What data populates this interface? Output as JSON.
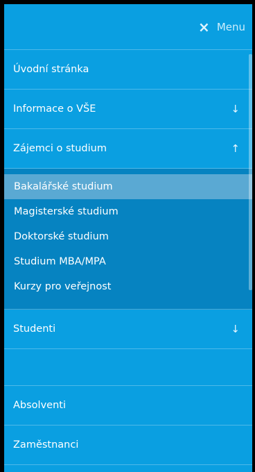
{
  "header": {
    "close_label": "Menu",
    "close_icon": "×"
  },
  "menu": {
    "uvod": "Úvodní stránka",
    "informace": "Informace o VŠE",
    "zajemci": "Zájemci o studium",
    "studenti": "Studenti",
    "absolventi": "Absolventi",
    "zamestnanci": "Zaměstnanci",
    "arrow_down": "↓",
    "arrow_up": "↑"
  },
  "submenu": [
    "Bakalářské studium",
    "Magisterské studium",
    "Doktorské studium",
    "Studium MBA/MPA",
    "Kurzy pro veřejnost"
  ]
}
